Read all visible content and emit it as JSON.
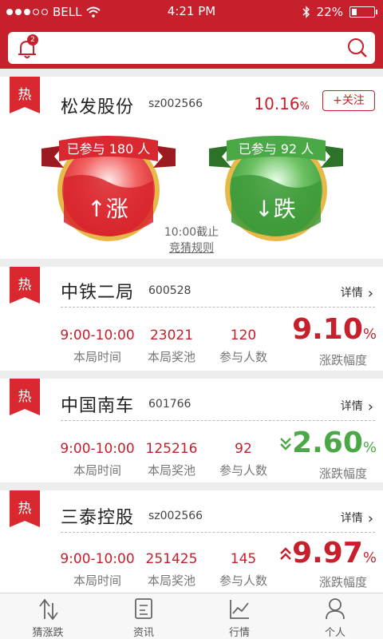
{
  "status": {
    "carrier": "BELL",
    "time": "4:21 PM",
    "battery": "22%",
    "battery_level": 0.22
  },
  "header": {
    "notif_count": "2"
  },
  "colors": {
    "brand_red": "#c6202c",
    "up_green": "#4ba846",
    "bg": "#ededed"
  },
  "featured": {
    "hot": "热",
    "name": "松发股份",
    "code": "sz002566",
    "pct": "10.16",
    "pct_unit": "%",
    "follow": "+关注",
    "up": {
      "count_text": "已参与 180 人",
      "label": "↑涨"
    },
    "down": {
      "count_text": "已参与 92 人",
      "label": "↓跌"
    },
    "deadline": "10:00截止",
    "rules": "竞猜规则"
  },
  "labels": {
    "time": "本局时间",
    "pool": "本局奖池",
    "people": "参与人数",
    "range": "涨跌幅度",
    "detail": "详情"
  },
  "stocks": [
    {
      "hot": "热",
      "name": "中铁二局",
      "code": "600528",
      "time": "9:00-10:00",
      "pool": "23021",
      "people": "120",
      "pct": "9.10",
      "unit": "%",
      "arrow": ""
    },
    {
      "hot": "热",
      "name": "中国南车",
      "code": "601766",
      "time": "9:00-10:00",
      "pool": "125216",
      "people": "92",
      "pct": "2.60",
      "unit": "%",
      "arrow": "down"
    },
    {
      "hot": "热",
      "name": "三泰控股",
      "code": "sz002566",
      "time": "9:00-10:00",
      "pool": "251425",
      "people": "145",
      "pct": "9.97",
      "unit": "%",
      "arrow": "up"
    }
  ],
  "tabs": [
    {
      "label": "猜涨跌",
      "icon": "chart-up-down-icon"
    },
    {
      "label": "资讯",
      "icon": "news-icon"
    },
    {
      "label": "行情",
      "icon": "trend-icon"
    },
    {
      "label": "个人",
      "icon": "person-icon"
    }
  ]
}
